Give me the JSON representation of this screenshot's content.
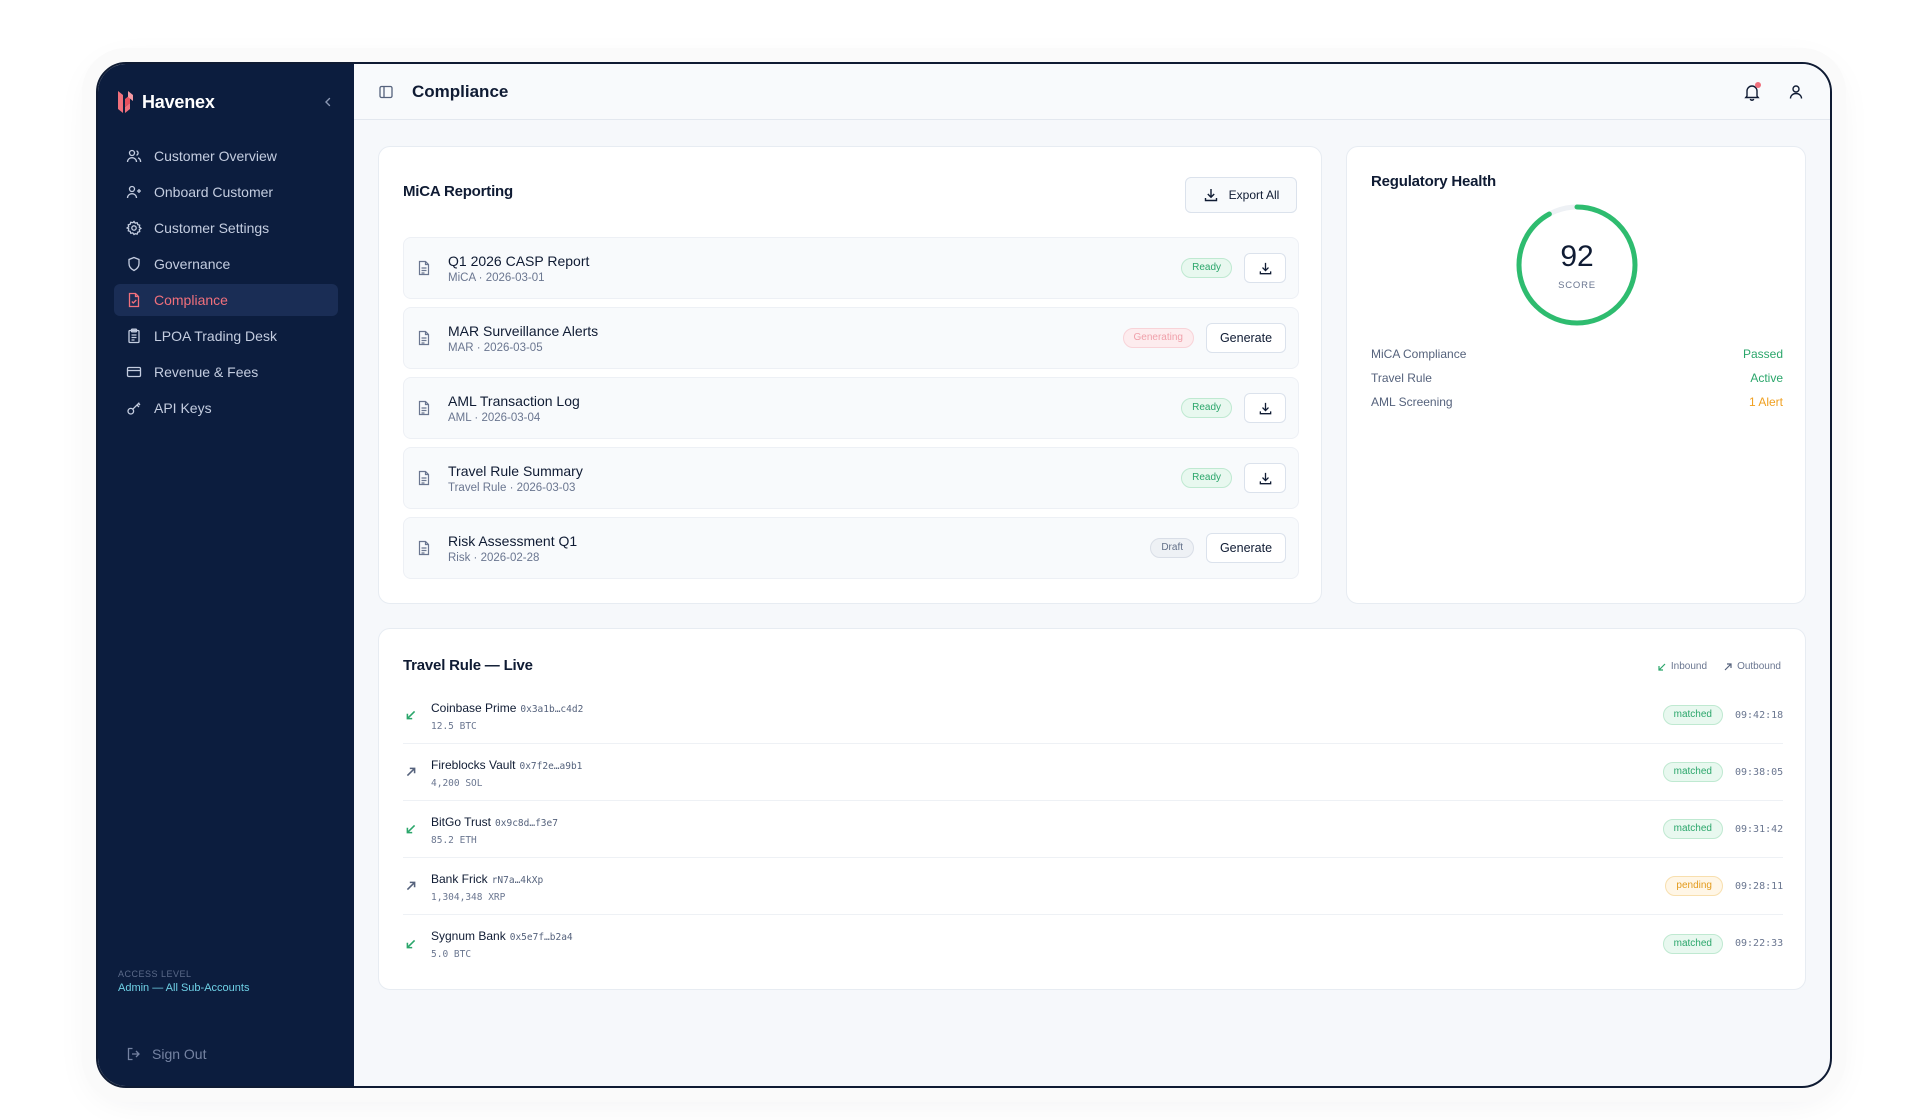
{
  "app": {
    "brand": "Havenex"
  },
  "sidebar": {
    "items": [
      {
        "label": "Customer Overview",
        "icon": "users-icon"
      },
      {
        "label": "Onboard Customer",
        "icon": "user-plus-icon"
      },
      {
        "label": "Customer Settings",
        "icon": "gear-icon"
      },
      {
        "label": "Governance",
        "icon": "shield-icon"
      },
      {
        "label": "Compliance",
        "icon": "document-check-icon",
        "active": true
      },
      {
        "label": "LPOA Trading Desk",
        "icon": "clipboard-icon"
      },
      {
        "label": "Revenue & Fees",
        "icon": "credit-card-icon"
      },
      {
        "label": "API Keys",
        "icon": "key-icon"
      }
    ],
    "access_label": "ACCESS LEVEL",
    "access_value": "Admin — All Sub-Accounts",
    "signout": "Sign Out"
  },
  "header": {
    "title": "Compliance"
  },
  "mica": {
    "title": "MiCA Reporting",
    "export_label": "Export All",
    "reports": [
      {
        "name": "Q1 2026 CASP Report",
        "meta": "MiCA · 2026-03-01",
        "status": "Ready",
        "action": "download"
      },
      {
        "name": "MAR Surveillance Alerts",
        "meta": "MAR · 2026-03-05",
        "status": "Generating",
        "action": "Generate"
      },
      {
        "name": "AML Transaction Log",
        "meta": "AML · 2026-03-04",
        "status": "Ready",
        "action": "download"
      },
      {
        "name": "Travel Rule Summary",
        "meta": "Travel Rule · 2026-03-03",
        "status": "Ready",
        "action": "download"
      },
      {
        "name": "Risk Assessment Q1",
        "meta": "Risk · 2026-02-28",
        "status": "Draft",
        "action": "Generate"
      }
    ]
  },
  "regulatory": {
    "title": "Regulatory Health",
    "score": "92",
    "score_value": 92,
    "score_label": "SCORE",
    "rows": [
      {
        "label": "MiCA Compliance",
        "value": "Passed",
        "color": "#2ba66b"
      },
      {
        "label": "Travel Rule",
        "value": "Active",
        "color": "#2ba66b"
      },
      {
        "label": "AML Screening",
        "value": "1 Alert",
        "color": "#f0a020"
      }
    ]
  },
  "travel": {
    "title": "Travel Rule — Live",
    "legend_inbound": "Inbound",
    "legend_outbound": "Outbound",
    "rows": [
      {
        "name": "Coinbase Prime",
        "addr": "0x3a1b…c4d2",
        "amount": "12.5 BTC",
        "status": "matched",
        "time": "09:42:18",
        "direction": "inbound"
      },
      {
        "name": "Fireblocks Vault",
        "addr": "0x7f2e…a9b1",
        "amount": "4,200 SOL",
        "status": "matched",
        "time": "09:38:05",
        "direction": "outbound"
      },
      {
        "name": "BitGo Trust",
        "addr": "0x9c8d…f3e7",
        "amount": "85.2 ETH",
        "status": "matched",
        "time": "09:31:42",
        "direction": "inbound"
      },
      {
        "name": "Bank Frick",
        "addr": "rN7a…4kXp",
        "amount": "1,304,348 XRP",
        "status": "pending",
        "time": "09:28:11",
        "direction": "outbound"
      },
      {
        "name": "Sygnum Bank",
        "addr": "0x5e7f…b2a4",
        "amount": "5.0 BTC",
        "status": "matched",
        "time": "09:22:33",
        "direction": "inbound"
      }
    ]
  },
  "colors": {
    "sidebar_bg": "#0c1d3e",
    "accent": "#f0707c",
    "success": "#2ba66b",
    "warning": "#f0a020"
  }
}
